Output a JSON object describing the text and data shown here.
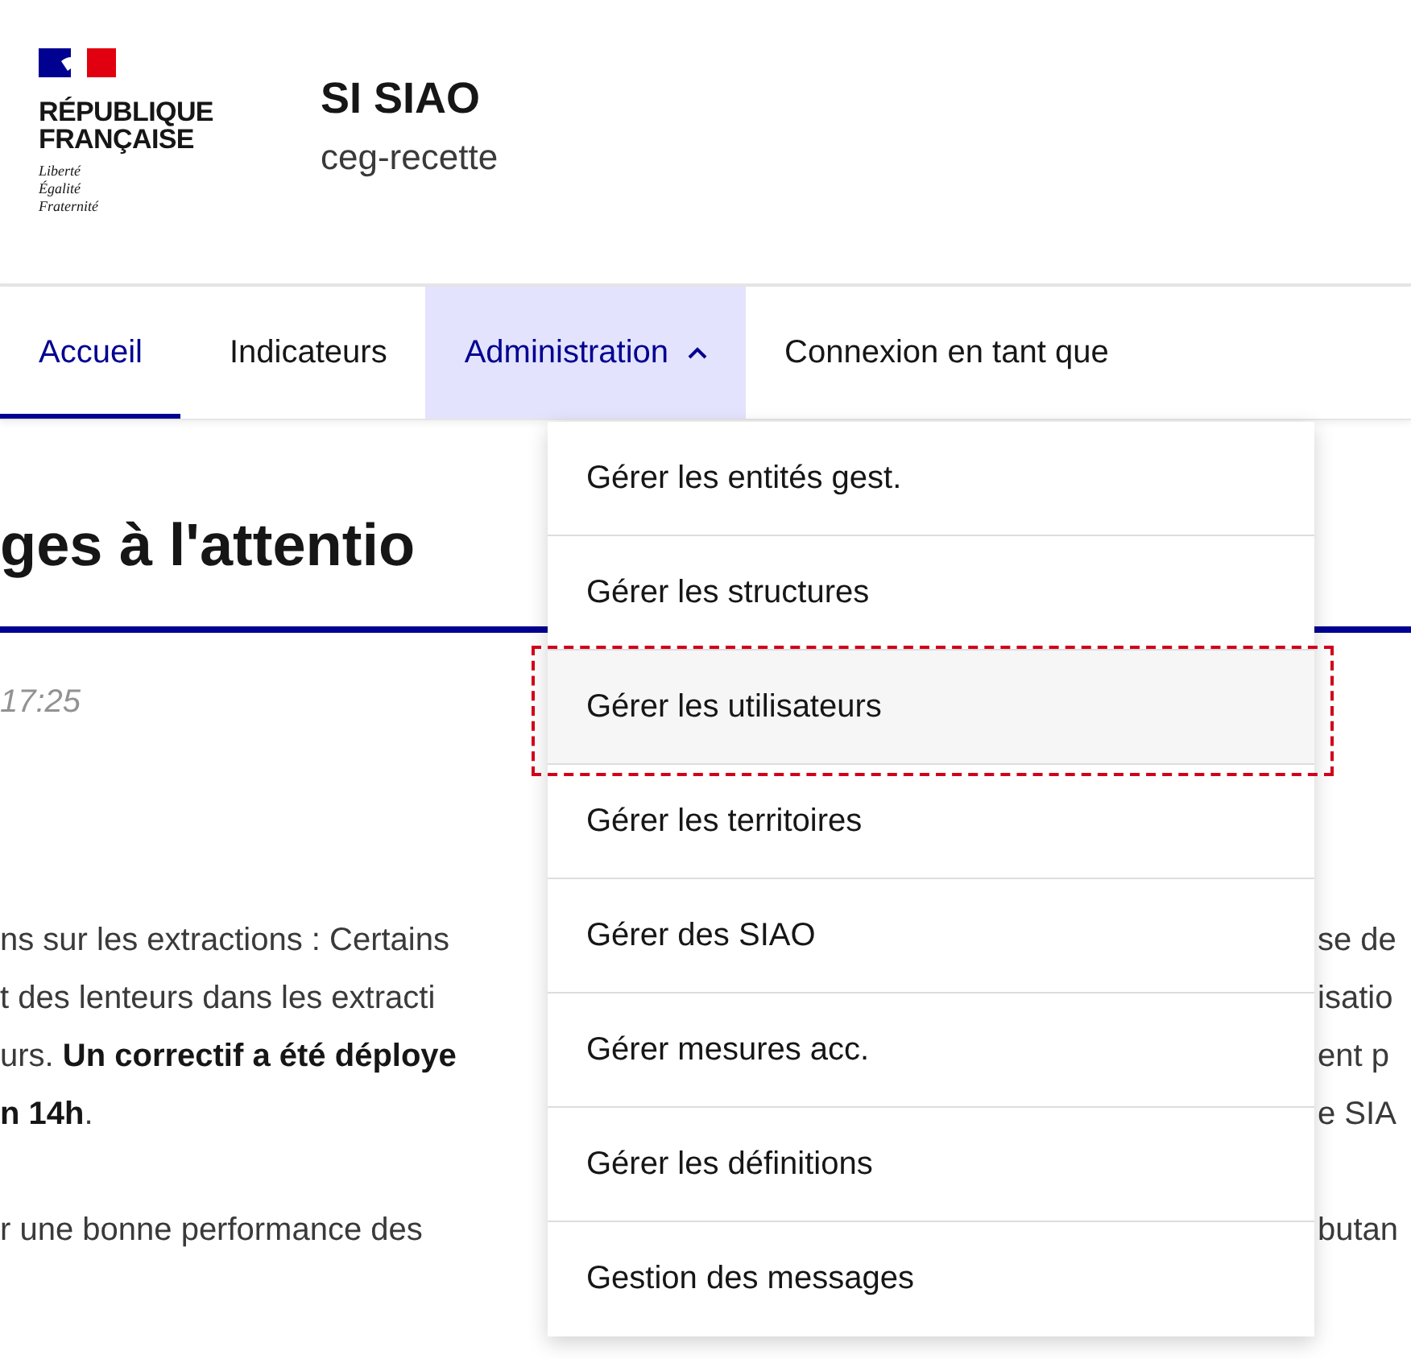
{
  "header": {
    "logo_lines": [
      "RÉPUBLIQUE",
      "FRANÇAISE"
    ],
    "motto": [
      "Liberté",
      "Égalité",
      "Fraternité"
    ],
    "service_title": "SI SIAO",
    "service_tagline": "ceg-recette"
  },
  "nav": [
    {
      "label": "Accueil",
      "selected": true,
      "expanded": false,
      "has_menu": false
    },
    {
      "label": "Indicateurs",
      "selected": false,
      "expanded": false,
      "has_menu": false
    },
    {
      "label": "Administration",
      "selected": false,
      "expanded": true,
      "has_menu": true
    },
    {
      "label": "Connexion en tant que",
      "selected": false,
      "expanded": false,
      "has_menu": false
    }
  ],
  "menu": [
    {
      "label": "Gérer les entités gest.",
      "highlighted": false
    },
    {
      "label": "Gérer les structures",
      "highlighted": false
    },
    {
      "label": "Gérer les utilisateurs",
      "highlighted": true
    },
    {
      "label": "Gérer les territoires",
      "highlighted": false
    },
    {
      "label": "Gérer des SIAO",
      "highlighted": false
    },
    {
      "label": "Gérer mesures acc.",
      "highlighted": false
    },
    {
      "label": "Gérer les définitions",
      "highlighted": false
    },
    {
      "label": "Gestion des messages",
      "highlighted": false
    }
  ],
  "content": {
    "heading": "ges à l'attentio",
    "date": "17:25",
    "left_paragraphs": [
      [
        "ns sur les extractions : Certains",
        "t des lenteurs dans les extracti",
        "urs. **Un correctif a été déploye**",
        "**n 14h**."
      ],
      [
        "r une bonne performance des"
      ]
    ],
    "right_paragraphs": [
      [
        "se de",
        "isatio",
        "ent p",
        "e SIA"
      ],
      [
        "butan"
      ]
    ]
  }
}
